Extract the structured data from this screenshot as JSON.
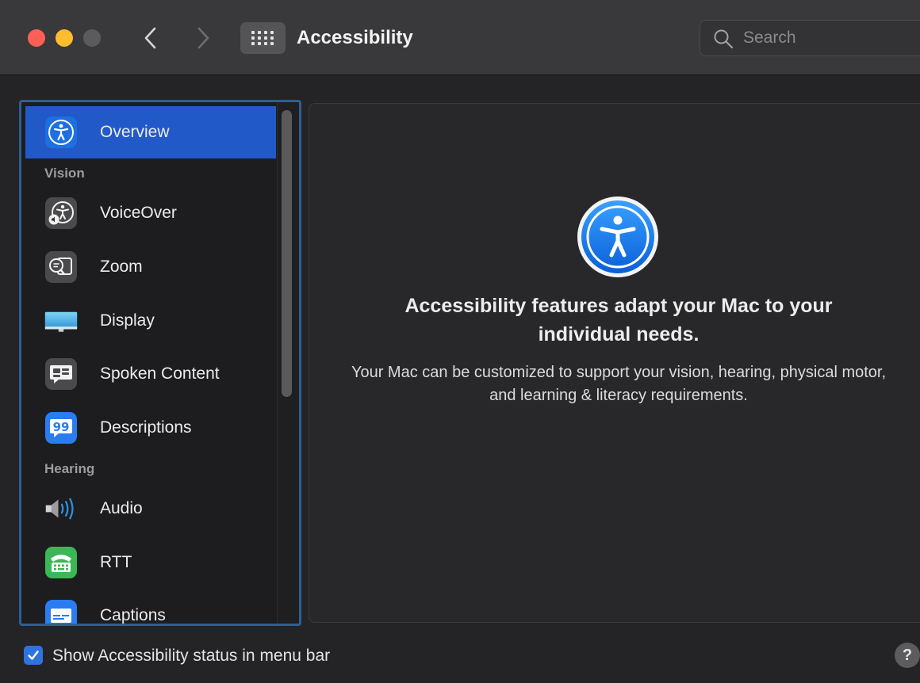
{
  "window": {
    "title": "Accessibility",
    "search_placeholder": "Search"
  },
  "sidebar": {
    "items": [
      {
        "label": "Overview",
        "icon": "accessibility-icon",
        "selected": true
      },
      {
        "label": "VoiceOver",
        "icon": "voiceover-icon"
      },
      {
        "label": "Zoom",
        "icon": "zoom-icon"
      },
      {
        "label": "Display",
        "icon": "display-icon"
      },
      {
        "label": "Spoken Content",
        "icon": "spoken-content-icon"
      },
      {
        "label": "Descriptions",
        "icon": "descriptions-icon"
      },
      {
        "label": "Audio",
        "icon": "audio-icon"
      },
      {
        "label": "RTT",
        "icon": "rtt-icon"
      },
      {
        "label": "Captions",
        "icon": "captions-icon"
      }
    ],
    "sections": {
      "vision": "Vision",
      "hearing": "Hearing"
    }
  },
  "detail": {
    "headline": "Accessibility features adapt your Mac to your individual needs.",
    "description": "Your Mac can be customized to support your vision, hearing, physical motor, and learning & literacy requirements."
  },
  "footer": {
    "status_checkbox_label": "Show Accessibility status in menu bar",
    "status_checkbox_checked": true,
    "help_label": "?"
  },
  "colors": {
    "selection": "#2159c9",
    "accent": "#2f73df",
    "close": "#fe5f57",
    "minimize": "#febc2e"
  }
}
